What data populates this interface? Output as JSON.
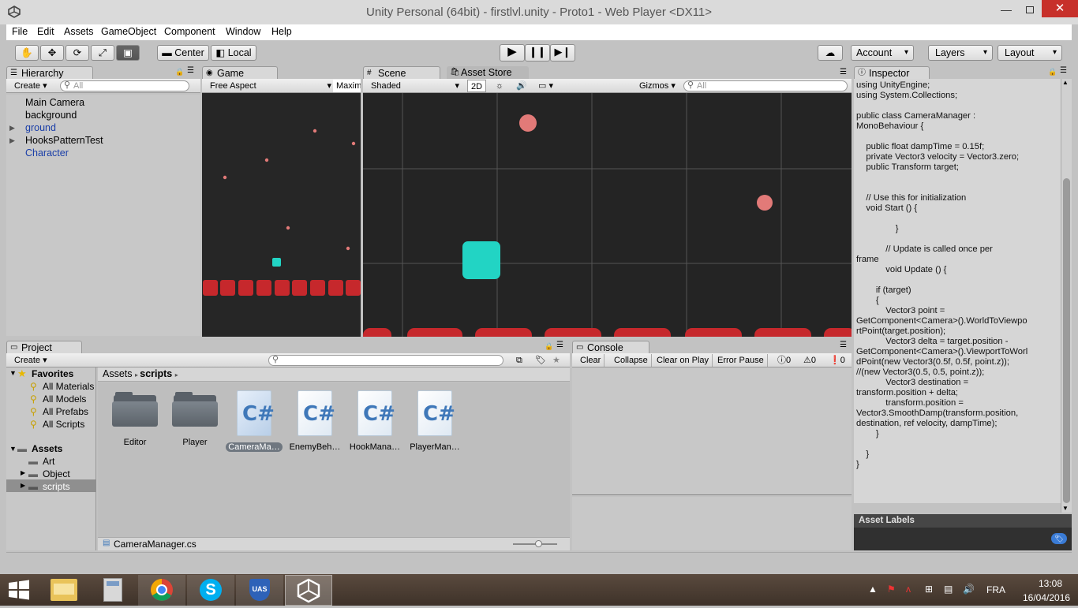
{
  "window": {
    "title": "Unity Personal (64bit) - firstlvl.unity - Proto1 - Web Player <DX11>"
  },
  "menu": [
    "File",
    "Edit",
    "Assets",
    "GameObject",
    "Component",
    "Window",
    "Help"
  ],
  "toolbar": {
    "center": "Center",
    "local": "Local",
    "account": "Account",
    "layers": "Layers",
    "layout": "Layout"
  },
  "hierarchy": {
    "tab": "Hierarchy",
    "create": "Create",
    "search_placeholder": "All",
    "items": [
      {
        "label": "Main Camera",
        "color": "#000000"
      },
      {
        "label": "background",
        "color": "#000000"
      },
      {
        "label": "ground",
        "color": "#1a3ea8"
      },
      {
        "label": "HooksPatternTest",
        "color": "#000000"
      },
      {
        "label": "Character",
        "color": "#1a3ea8"
      }
    ]
  },
  "game": {
    "tab": "Game",
    "aspect": "Free Aspect",
    "maximize": "Maxim"
  },
  "scene": {
    "tab": "Scene",
    "asset_store_tab": "Asset Store",
    "shading": "Shaded",
    "mode_2d": "2D",
    "gizmos": "Gizmos",
    "search_placeholder": "All"
  },
  "inspector": {
    "tab": "Inspector",
    "code": [
      "using UnityEngine;",
      "using System.Collections;",
      "",
      "public class CameraManager :",
      "MonoBehaviour {",
      "",
      "    public float dampTime = 0.15f;",
      "    private Vector3 velocity = Vector3.zero;",
      "    public Transform target;",
      "",
      "",
      "    // Use this for initialization",
      "    void Start () {",
      "",
      "                }",
      "",
      "            // Update is called once per",
      "frame",
      "            void Update () {",
      "",
      "        if (target)",
      "        {",
      "            Vector3 point =",
      "GetComponent<Camera>().WorldToViewpo",
      "rtPoint(target.position);",
      "            Vector3 delta = target.position -",
      "GetComponent<Camera>().ViewportToWorl",
      "dPoint(new Vector3(0.5f, 0.5f, point.z));",
      "//(new Vector3(0.5, 0.5, point.z));",
      "            Vector3 destination =",
      "transform.position + delta;",
      "            transform.position =",
      "Vector3.SmoothDamp(transform.position,",
      "destination, ref velocity, dampTime);",
      "        }",
      "",
      "    }",
      "}"
    ],
    "asset_labels": "Asset Labels"
  },
  "project": {
    "tab": "Project",
    "create": "Create",
    "favorites_label": "Favorites",
    "favorites": [
      "All Materials",
      "All Models",
      "All Prefabs",
      "All Scripts"
    ],
    "assets_label": "Assets",
    "folders": [
      "Art",
      "Object",
      "scripts"
    ],
    "breadcrumb": [
      "Assets",
      "scripts"
    ],
    "items": [
      {
        "label": "Editor",
        "kind": "folder"
      },
      {
        "label": "Player",
        "kind": "folder"
      },
      {
        "label": "CameraMa…",
        "kind": "script"
      },
      {
        "label": "EnemyBeh…",
        "kind": "script"
      },
      {
        "label": "HookMana…",
        "kind": "script"
      },
      {
        "label": "PlayerMan…",
        "kind": "script"
      }
    ],
    "selected_file": "CameraManager.cs"
  },
  "console": {
    "tab": "Console",
    "buttons": [
      "Clear",
      "Collapse",
      "Clear on Play",
      "Error Pause"
    ],
    "counts": [
      "0",
      "0",
      "0"
    ]
  },
  "taskbar": {
    "lang": "FRA",
    "time": "13:08",
    "date": "16/04/2016"
  },
  "colors": {
    "accent_cyan": "#22d4c4",
    "ground_red": "#c6282c",
    "dot_pink": "#e27a78"
  }
}
